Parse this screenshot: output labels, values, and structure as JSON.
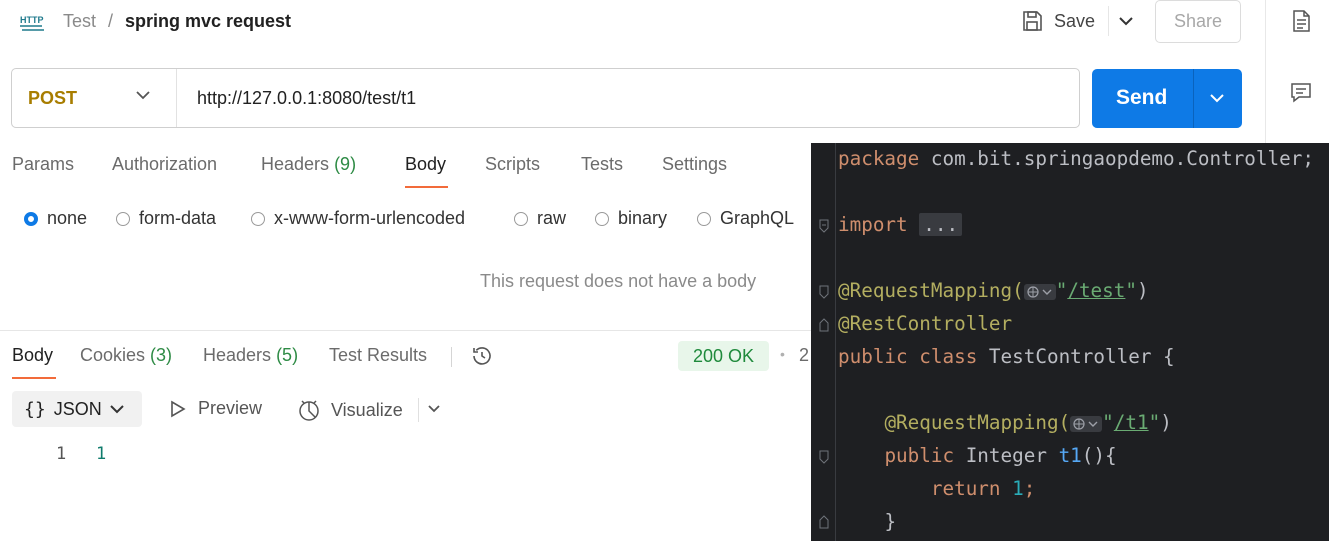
{
  "header": {
    "breadcrumb_parent": "Test",
    "breadcrumb_separator": "/",
    "title": "spring mvc request",
    "save_label": "Save",
    "share_label": "Share"
  },
  "request": {
    "method": "POST",
    "url": "http://127.0.0.1:8080/test/t1",
    "send_label": "Send",
    "tabs": [
      {
        "label": "Params",
        "count": ""
      },
      {
        "label": "Authorization",
        "count": ""
      },
      {
        "label": "Headers",
        "count": "(9)"
      },
      {
        "label": "Body",
        "count": ""
      },
      {
        "label": "Scripts",
        "count": ""
      },
      {
        "label": "Tests",
        "count": ""
      },
      {
        "label": "Settings",
        "count": ""
      }
    ],
    "body_types": [
      "none",
      "form-data",
      "x-www-form-urlencoded",
      "raw",
      "binary",
      "GraphQL"
    ],
    "selected_body_type": "none",
    "empty_body_message": "This request does not have a body"
  },
  "response": {
    "tabs": [
      {
        "label": "Body",
        "count": ""
      },
      {
        "label": "Cookies",
        "count": "(3)"
      },
      {
        "label": "Headers",
        "count": "(5)"
      },
      {
        "label": "Test Results",
        "count": ""
      }
    ],
    "status": "200 OK",
    "status_extra": "2",
    "format": "JSON",
    "preview_label": "Preview",
    "visualize_label": "Visualize",
    "lines": [
      {
        "number": "1",
        "value": "1"
      }
    ]
  },
  "colors": {
    "accent": "#0e7ae6",
    "method": "#a87d00",
    "tab_underline": "#f26b3a",
    "status_ok": "#1f8a3c",
    "ide_background": "#1e1f22"
  },
  "ide": {
    "package_kw": "package",
    "package_name": "com.bit.springaopdemo.Controller;",
    "import_kw": "import",
    "import_fold": "...",
    "mapping1_ann": "@RequestMapping(",
    "mapping1_path": "/test",
    "rest_ann": "@RestController",
    "class_mods": "public class",
    "class_name": "TestController {",
    "mapping2_path": "/t1",
    "method_mod": "public",
    "method_type": "Integer",
    "method_name": "t1",
    "method_sig": "(){",
    "return_kw": "return",
    "return_val": "1",
    "close_brace": "}"
  }
}
